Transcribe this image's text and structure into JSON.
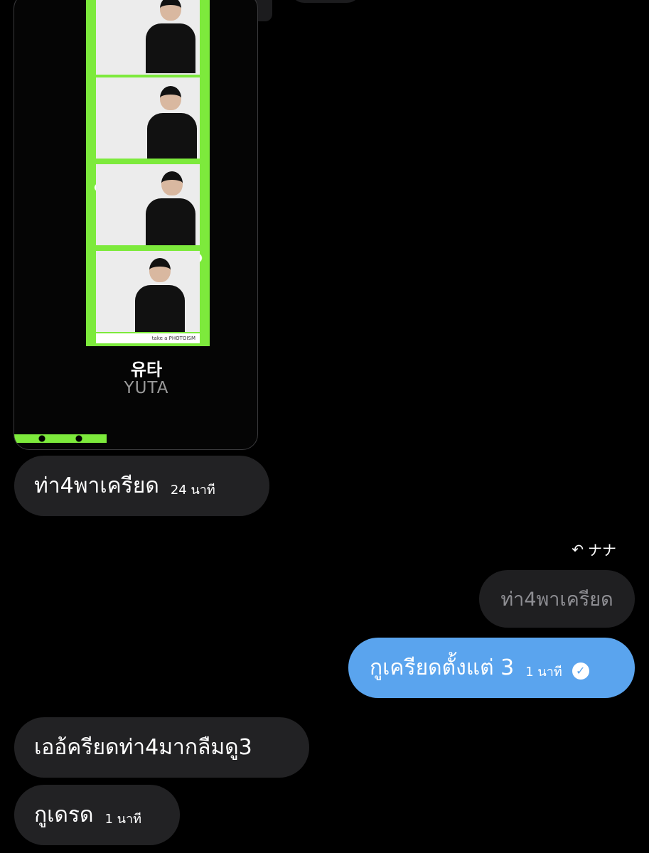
{
  "shared_card": {
    "title_korean": "유타",
    "title_english": "YUTA",
    "strip_caption": "take a PHOTOISM"
  },
  "messages": [
    {
      "direction": "incoming",
      "text": "ท่า4พาเครียด",
      "time": "24 นาที"
    },
    {
      "direction": "outgoing",
      "reply_to_name": "ナナ",
      "quoted_text": "ท่า4พาเครียด",
      "text": "กูเครียดตั้งแต่ 3",
      "time": "1 นาที",
      "status_icon": "check-circle-icon"
    },
    {
      "direction": "incoming",
      "text": "เออ้ครียดท่า4มากลืมดู3"
    },
    {
      "direction": "incoming",
      "text": "กูเดรด",
      "time": "1 นาที"
    }
  ],
  "colors": {
    "background": "#000000",
    "incoming_bubble": "#222224",
    "outgoing_bubble": "#5aa4ee",
    "strip_accent": "#7dea3c"
  }
}
